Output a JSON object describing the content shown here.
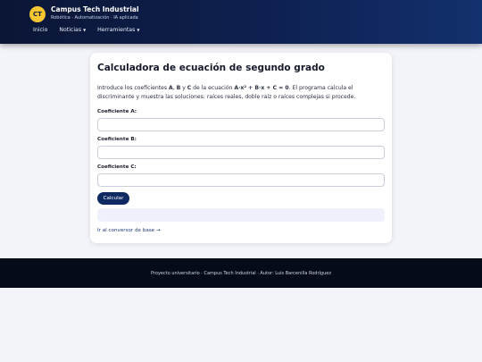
{
  "header": {
    "logo_text": "CT",
    "title": "Campus Tech Industrial",
    "subtitle": "Robótica · Automatización · IA aplicada",
    "nav": [
      {
        "label": "Inicio",
        "caret": ""
      },
      {
        "label": "Noticias",
        "caret": "▼"
      },
      {
        "label": "Herramientas",
        "caret": "▼"
      }
    ]
  },
  "card": {
    "title": "Calculadora de ecuación de segundo grado",
    "intro": {
      "p1": "Introduce los coeficientes ",
      "a": "A",
      "comma1": ", ",
      "b": "B",
      "y": " y ",
      "c": "C",
      "p2": " de la ecuación ",
      "equation": "A·x² + B·x + C = 0",
      "p3": ". El programa calcula el discriminante y muestra las soluciones: raíces reales, doble raíz o raíces complejas si procede."
    },
    "fields": {
      "a_label": "Coeficiente A:",
      "a_value": "",
      "b_label": "Coeficiente B:",
      "b_value": "",
      "c_label": "Coeficiente C:",
      "c_value": ""
    },
    "calculate_label": "Calcular",
    "result_text": "",
    "link_label": "Ir al conversor de base →"
  },
  "footer": {
    "text": "Proyecto universitario · Campus Tech Industrial · Autor: Luis Barcenilla Rodríguez"
  },
  "colors": {
    "header_dark": "#0b1635",
    "logo_yellow": "#f7c631",
    "button_navy": "#0f2a63",
    "footer_bg": "#060b1a",
    "page_bg": "#f3f4f9"
  }
}
